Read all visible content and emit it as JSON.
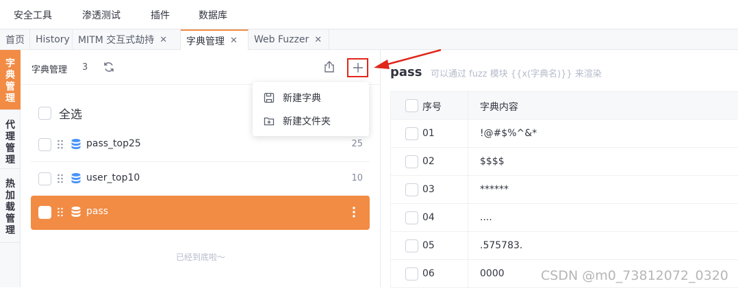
{
  "menubar": {
    "items": [
      "安全工具",
      "渗透测试",
      "插件",
      "数据库"
    ]
  },
  "tabs": [
    {
      "label": "首页",
      "closable": false,
      "active": false
    },
    {
      "label": "History",
      "closable": false,
      "active": false
    },
    {
      "label": "MITM 交互式劫持",
      "closable": true,
      "active": false
    },
    {
      "label": "字典管理",
      "closable": true,
      "active": true
    },
    {
      "label": "Web Fuzzer",
      "closable": true,
      "active": false
    }
  ],
  "close_glyph": "✕",
  "sidetabs": [
    {
      "label": "字典管理",
      "active": true
    },
    {
      "label": "代理管理",
      "active": false
    },
    {
      "label": "热加载管理",
      "active": false
    }
  ],
  "left_panel": {
    "title": "字典管理",
    "count": "3",
    "icons": {
      "refresh": "refresh-icon",
      "export": "export-icon",
      "add": "plus-icon"
    },
    "select_all_label": "全选",
    "items": [
      {
        "name": "pass_top25",
        "count": "25",
        "selected": false
      },
      {
        "name": "user_top10",
        "count": "10",
        "selected": false
      },
      {
        "name": "pass",
        "count": "",
        "selected": true
      }
    ],
    "bottom_tip": "已经到底啦～"
  },
  "dropdown": {
    "items": [
      {
        "label": "新建字典",
        "icon": "save-icon"
      },
      {
        "label": "新建文件夹",
        "icon": "folder-plus-icon"
      }
    ]
  },
  "right_panel": {
    "title": "pass",
    "description": "可以通过 fuzz 模块 {{x(字典名)}} 来渲染",
    "columns": [
      "序号",
      "字典内容"
    ],
    "rows": [
      {
        "index": "01",
        "content": "!@#$%^&*"
      },
      {
        "index": "02",
        "content": "$$$$"
      },
      {
        "index": "03",
        "content": "******"
      },
      {
        "index": "04",
        "content": "...."
      },
      {
        "index": "05",
        "content": ".575783."
      },
      {
        "index": "06",
        "content": "0000"
      }
    ]
  },
  "colors": {
    "accent": "#f28b44",
    "highlight_border": "#e0251a",
    "arrow": "#e0251a",
    "db_icon_blue": "#4a94f8"
  },
  "watermark": "CSDN @m0_73812072_0320"
}
